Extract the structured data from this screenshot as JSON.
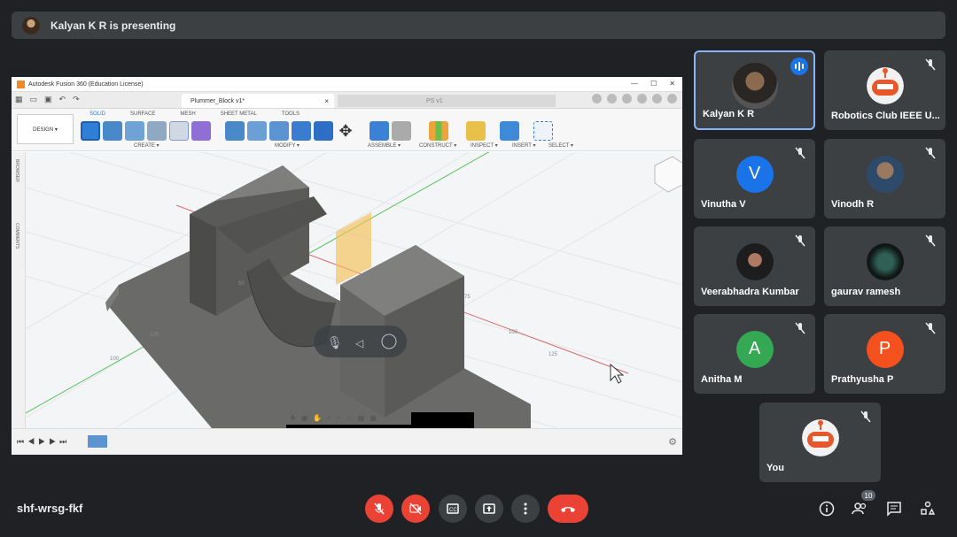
{
  "presenting": {
    "text": "Kalyan K R is presenting"
  },
  "fusion": {
    "window_title": "Autodesk Fusion 360 (Education License)",
    "doc_tab": "Plummer_Block v1*",
    "doc_tab_close": "×",
    "second_tab": "PS v1",
    "workspace": "DESIGN ▾",
    "workspace_tabs": [
      "SOLID",
      "SURFACE",
      "MESH",
      "SHEET METAL",
      "TOOLS"
    ],
    "groups": [
      "CREATE ▾",
      "MODIFY ▾",
      "ASSEMBLE ▾",
      "CONSTRUCT ▾",
      "INSPECT ▾",
      "INSERT ▾",
      "SELECT ▾"
    ],
    "side_labels": [
      "BROWSER",
      "COMMENTS"
    ],
    "dim_labels": [
      "100",
      "125",
      "50",
      "75",
      "100",
      "125"
    ]
  },
  "participants": [
    {
      "name": "Kalyan K R",
      "avatar_type": "photo",
      "speaking": true
    },
    {
      "name": "Robotics Club IEEE U...",
      "avatar_type": "robot",
      "muted": true
    },
    {
      "name": "Vinutha V",
      "initial": "V",
      "color": "#1a73e8",
      "muted": true
    },
    {
      "name": "Vinodh R",
      "avatar_type": "photo",
      "muted": true
    },
    {
      "name": "Veerabhadra Kumbar",
      "avatar_type": "photo",
      "muted": true
    },
    {
      "name": "gaurav ramesh",
      "avatar_type": "photo",
      "muted": true
    },
    {
      "name": "Anitha M",
      "initial": "A",
      "color": "#34a853",
      "muted": true
    },
    {
      "name": "Prathyusha P",
      "initial": "P",
      "color": "#f4511e",
      "muted": true
    },
    {
      "name": "You",
      "avatar_type": "robot",
      "muted": true
    }
  ],
  "meeting": {
    "code": "shf-wrsg-fkf",
    "participant_count": "10"
  },
  "controls": [
    "mic-off-icon",
    "camera-off-icon",
    "captions-icon",
    "present-icon",
    "more-icon",
    "end-call-icon"
  ],
  "colors": {
    "bg": "#202124",
    "tile": "#3c4043",
    "red": "#ea4335",
    "blue": "#1a73e8"
  }
}
